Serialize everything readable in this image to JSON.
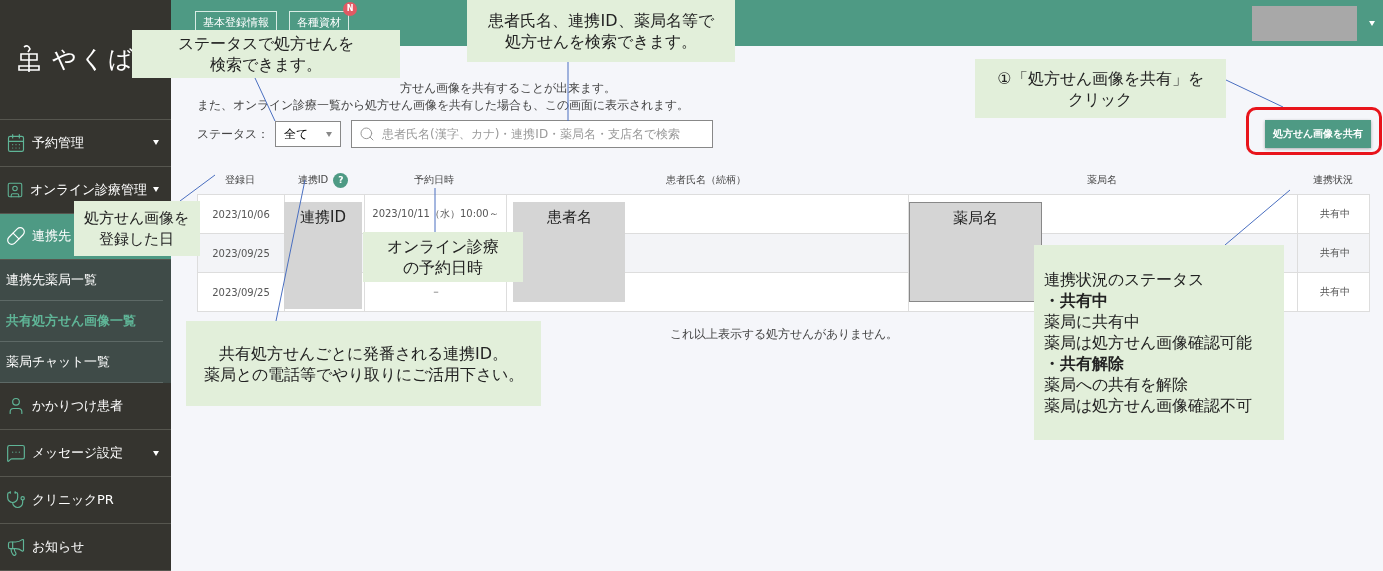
{
  "header": {
    "buttons": [
      {
        "label": "基本登録情報"
      },
      {
        "label": "各種資材",
        "badge": "N"
      }
    ]
  },
  "sidebar": {
    "logo": "やくば",
    "items": [
      {
        "label": "予約管理",
        "expandable": true,
        "selected": false
      },
      {
        "label": "オンライン診療管理",
        "expandable": true,
        "selected": false
      },
      {
        "label": "連携先",
        "expandable": false,
        "selected": true,
        "children": [
          {
            "label": "連携先薬局一覧",
            "selected": false
          },
          {
            "label": "共有処方せん画像一覧",
            "selected": true
          },
          {
            "label": "薬局チャット一覧",
            "selected": false
          }
        ]
      },
      {
        "label": "かかりつけ患者",
        "expandable": false,
        "selected": false
      },
      {
        "label": "メッセージ設定",
        "expandable": true,
        "selected": false
      },
      {
        "label": "クリニックPR",
        "expandable": false,
        "selected": false
      },
      {
        "label": "お知らせ",
        "expandable": false,
        "selected": false
      }
    ]
  },
  "intro_lines": [
    "方せん画像を共有することが出来ます。",
    "また、オンライン診療一覧から処方せん画像を共有した場合も、この画面に表示されます。"
  ],
  "status_filter": {
    "label": "ステータス：",
    "value": "全て"
  },
  "search": {
    "placeholder": "患者氏名(漢字、カナ)・連携ID・薬局名・支店名で検索"
  },
  "share_button": "処方せん画像を共有",
  "table": {
    "columns": [
      {
        "label": "登録日"
      },
      {
        "label": "連携ID",
        "help": "?"
      },
      {
        "label": "予約日時"
      },
      {
        "label": "患者氏名（続柄）"
      },
      {
        "label": "薬局名"
      },
      {
        "label": "連携状況"
      }
    ],
    "rows": [
      {
        "registered": "2023/10/06",
        "reservation": "2023/10/11（水）10:00～",
        "status": "共有中"
      },
      {
        "registered": "2023/09/25",
        "status": "共有中"
      },
      {
        "registered": "2023/09/25",
        "reservation": "－",
        "status": "共有中"
      }
    ]
  },
  "masked_fields": [
    "連携ID",
    "患者名",
    "薬局名"
  ],
  "footer_note": "これ以上表示する処方せんがありません。",
  "callouts": [
    {
      "text": "ステータスで処方せんを検索できます。"
    },
    {
      "text": "患者氏名、連携ID、薬局名等で処方せんを検索できます。"
    },
    {
      "text": "①「処方せん画像を共有」をクリック"
    },
    {
      "text": "処方せん画像を登録した日"
    },
    {
      "text": "オンライン診療の予約日時"
    },
    {
      "lines": [
        {
          "text": "共有処方せんごとに発番される連携ID。"
        },
        {
          "text": "薬局との電話等でやり取りにご活用下さい。"
        }
      ]
    },
    {
      "lines": [
        {
          "text": "連携状況のステータス",
          "bold": false
        },
        {
          "text": "・共有中",
          "bold": true
        },
        {
          "text": "薬局に共有中",
          "bold": false
        },
        {
          "text": "薬局は処方せん画像確認可能",
          "bold": false
        },
        {
          "text": "・共有解除",
          "bold": true
        },
        {
          "text": "薬局への共有を解除",
          "bold": false
        },
        {
          "text": "薬局は処方せん画像確認不可",
          "bold": false
        }
      ]
    }
  ]
}
